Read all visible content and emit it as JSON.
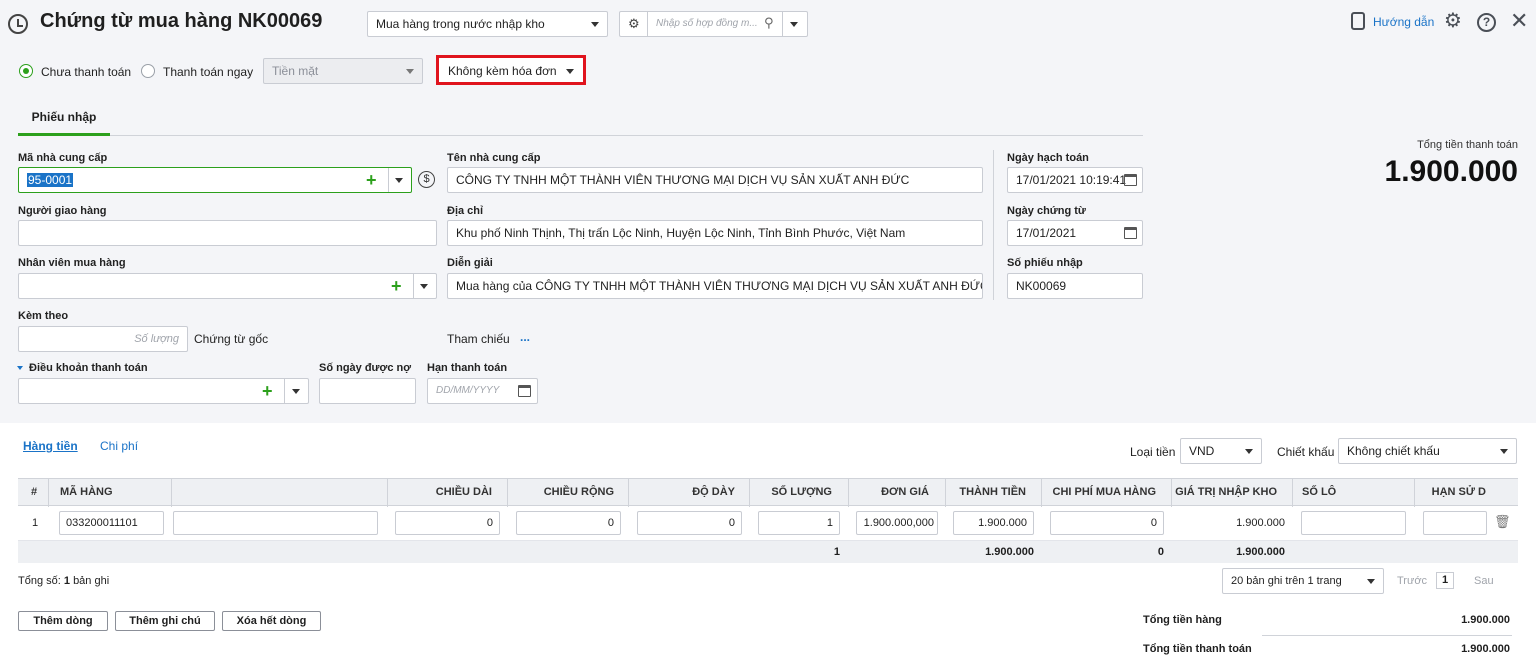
{
  "header": {
    "title": "Chứng từ mua hàng NK00069",
    "voucher_type": "Mua hàng trong nước nhập kho",
    "contract_placeholder": "Nhập số hợp đồng m...",
    "guide_label": "Hướng dẫn"
  },
  "payment": {
    "unpaid_label": "Chưa thanh toán",
    "paid_label": "Thanh toán ngay",
    "method": "Tiền mặt",
    "invoice_option": "Không kèm hóa đơn"
  },
  "tabs": {
    "receipt": "Phiếu nhập"
  },
  "form": {
    "supplier_code_label": "Mã nhà cung cấp",
    "supplier_code": "95-0001",
    "supplier_name_label": "Tên nhà cung cấp",
    "supplier_name": "CÔNG TY TNHH MỘT THÀNH VIÊN THƯƠNG MẠI DỊCH VỤ SẢN XUẤT ANH ĐỨC",
    "deliverer_label": "Người giao hàng",
    "address_label": "Địa chỉ",
    "address": "Khu phố Ninh Thịnh, Thị trấn Lộc Ninh, Huyện Lộc Ninh, Tỉnh Bình Phước, Việt Nam",
    "buyer_label": "Nhân viên mua hàng",
    "description_label": "Diễn giải",
    "description": "Mua hàng của CÔNG TY TNHH MỘT THÀNH VIÊN THƯƠNG MẠI DỊCH VỤ SẢN XUẤT ANH ĐỨC",
    "attach_label": "Kèm theo",
    "quantity_placeholder": "Số lượng",
    "original_docs": "Chứng từ gốc",
    "reference_label": "Tham chiếu",
    "reference_more": "...",
    "terms_label": "Điều khoản thanh toán",
    "credit_days_label": "Số ngày được nợ",
    "due_date_label": "Hạn thanh toán",
    "due_date_placeholder": "DD/MM/YYYY",
    "posting_date_label": "Ngày hạch toán",
    "posting_date": "17/01/2021 10:19:41",
    "voucher_date_label": "Ngày chứng từ",
    "voucher_date": "17/01/2021",
    "receipt_no_label": "Số phiếu nhập",
    "receipt_no": "NK00069"
  },
  "summary": {
    "total_label": "Tổng tiền thanh toán",
    "total": "1.900.000"
  },
  "detail": {
    "tab_goods": "Hàng tiền",
    "tab_cost": "Chi phí",
    "currency_label": "Loại tiền",
    "currency": "VND",
    "discount_label": "Chiết khấu",
    "discount": "Không chiết khấu",
    "columns": [
      "#",
      "MÃ HÀNG",
      "",
      "CHIỀU DÀI",
      "CHIỀU RỘNG",
      "ĐỘ DÀY",
      "SỐ LƯỢNG",
      "ĐƠN GIÁ",
      "THÀNH TIỀN",
      "CHI PHÍ MUA HÀNG",
      "GIÁ TRỊ NHẬP KHO",
      "SỐ LÔ",
      "HẠN SỬ D"
    ],
    "row": {
      "no": "1",
      "code": "033200011101",
      "length": "0",
      "width": "0",
      "thickness": "0",
      "quantity": "1",
      "unit_price": "1.900.000,000",
      "amount": "1.900.000",
      "purchase_cost": "0",
      "stock_value": "1.900.000"
    },
    "totals": {
      "quantity": "1",
      "amount": "1.900.000",
      "purchase_cost": "0",
      "stock_value": "1.900.000"
    },
    "record_count_prefix": "Tổng số:",
    "record_count": "1",
    "record_count_suffix": "bản ghi",
    "page_size": "20 bản ghi trên 1 trang",
    "prev": "Trước",
    "page": "1",
    "next": "Sau"
  },
  "buttons": {
    "add_row": "Thêm dòng",
    "add_note": "Thêm ghi chú",
    "clear_rows": "Xóa hết dòng"
  },
  "footer": {
    "goods_total_label": "Tổng tiền hàng",
    "goods_total": "1.900.000",
    "payment_total_label": "Tổng tiền thanh toán",
    "payment_total": "1.900.000"
  }
}
